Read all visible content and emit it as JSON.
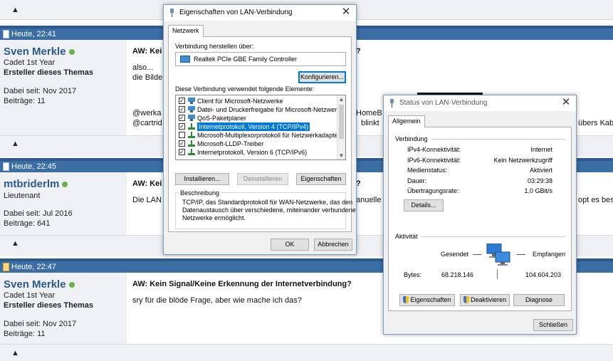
{
  "forum": {
    "posts": [
      {
        "time": "Heute, 22:41",
        "user": "Sven Merkle",
        "rank": "Cadet 1st Year",
        "starter": "Ersteller dieses Themas",
        "joined": "Dabei seit: Nov 2017",
        "posts": "Beiträge: 11",
        "title": "AW: Kei",
        "title_right": "?",
        "lines": [
          "also...",
          "die Bilde",
          "",
          "@werka",
          "@cartrid"
        ],
        "right_text": [
          "HomeB",
          "blinkt",
          "übers Kab"
        ]
      },
      {
        "time": "Heute, 22:45",
        "user": "mtbriderlm",
        "rank": "Lieutenant",
        "starter": "",
        "joined": "Dabei seit: Jul 2016",
        "posts": "Beiträge: 641",
        "title": "AW: Kei",
        "title_right": "?",
        "lines": [
          "Die LAN"
        ],
        "right_text": [
          "anuelle",
          "opt es bes"
        ]
      },
      {
        "time": "Heute, 22:47",
        "user": "Sven Merkle",
        "rank": "Cadet 1st Year",
        "starter": "Ersteller dieses Themas",
        "joined": "Dabei seit: Nov 2017",
        "posts": "Beiträge: 11",
        "title": "AW: Kein Signal/Keine Erkennung der Internetverbindung?",
        "lines": [
          "sry für die blöde Frage, aber wie mache ich das?"
        ]
      }
    ]
  },
  "props": {
    "title": "Eigenschaften von LAN-Verbindung",
    "tab": "Netzwerk",
    "connect_label": "Verbindung herstellen über:",
    "adapter": "Realtek PCIe GBE Family Controller",
    "configure": "Konfigurieren...",
    "items_label": "Diese Verbindung verwendet folgende Elemente:",
    "items": [
      {
        "label": "Client für Microsoft-Netzwerke",
        "checked": true,
        "icon": "network-client-icon"
      },
      {
        "label": "Datei- und Druckerfreigabe für Microsoft-Netzwerke",
        "checked": true,
        "icon": "file-printer-share-icon"
      },
      {
        "label": "QoS-Paketplaner",
        "checked": true,
        "icon": "qos-icon"
      },
      {
        "label": "Internetprotokoll, Version 4 (TCP/IPv4)",
        "checked": true,
        "icon": "protocol-icon",
        "selected": true
      },
      {
        "label": "Microsoft-Multiplexorprotokoll für Netzwerkadapter",
        "checked": false,
        "icon": "protocol-icon"
      },
      {
        "label": "Microsoft-LLDP-Treiber",
        "checked": true,
        "icon": "protocol-icon"
      },
      {
        "label": "Internetprotokoll, Version 6 (TCP/IPv6)",
        "checked": true,
        "icon": "protocol-icon"
      }
    ],
    "install": "Installieren...",
    "uninstall": "Deinstallieren",
    "properties": "Eigenschaften",
    "desc_title": "Beschreibung",
    "desc_lines": [
      "TCP/IP, das Standardprotokoll für WAN-Netzwerke, das den",
      "Datenaustausch über verschiedene, miteinander verbundene",
      "Netzwerke ermöglicht."
    ],
    "ok": "OK",
    "cancel": "Abbrechen"
  },
  "status": {
    "title": "Status von LAN-Verbindung",
    "tab": "Allgemein",
    "connection_title": "Verbindung",
    "rows": [
      {
        "k": "IPv4-Konnektivität:",
        "v": "Internet"
      },
      {
        "k": "IPv6-Konnektivität:",
        "v": "Kein Netzwerkzugriff"
      },
      {
        "k": "Medienstatus:",
        "v": "Aktiviert"
      },
      {
        "k": "Dauer:",
        "v": "03:29:38"
      },
      {
        "k": "Übertragungsrate:",
        "v": "1,0 GBit/s"
      }
    ],
    "details": "Details...",
    "activity_title": "Aktivität",
    "sent_label": "Gesendet",
    "received_label": "Empfangen",
    "bytes_label": "Bytes:",
    "bytes_sent": "68.218.146",
    "bytes_received": "104.604.203",
    "btn_properties": "Eigenschaften",
    "btn_disable": "Deaktivieren",
    "btn_diagnose": "Diagnose",
    "close": "Schließen"
  }
}
